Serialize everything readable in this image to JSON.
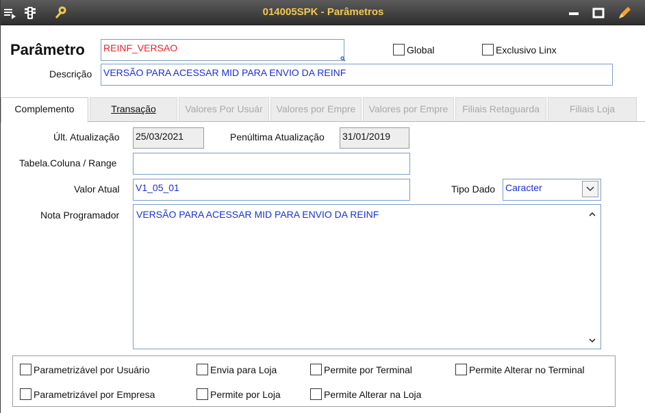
{
  "window": {
    "title": "014005SPK - Parâmetros",
    "icons": [
      "menu-list-icon",
      "traffic-light-icon",
      "wrench-icon",
      "minimize-icon",
      "maximize-icon",
      "pencil-icon"
    ]
  },
  "header": {
    "parametro_label": "Parâmetro",
    "parametro_value": "REINF_VERSAO",
    "descricao_label": "Descrição",
    "descricao_value": "VERSÃO PARA ACESSAR MID PARA ENVIO DA REINF",
    "global_label": "Global",
    "exclusivo_label": "Exclusivo Linx"
  },
  "tabs": [
    {
      "label": "Complemento",
      "state": "active"
    },
    {
      "label": "Transação",
      "state": "enabled"
    },
    {
      "label": "Valores Por Usuár",
      "state": "disabled"
    },
    {
      "label": "Valores por Empre",
      "state": "disabled"
    },
    {
      "label": "Valores por Empre",
      "state": "disabled"
    },
    {
      "label": "Filiais Retaguarda",
      "state": "disabled"
    },
    {
      "label": "Filiais Loja",
      "state": "disabled"
    }
  ],
  "complemento": {
    "ult_atualizacao_label": "Últ. Atualização",
    "ult_atualizacao_value": "25/03/2021",
    "penultima_label": "Penúltima Atualização",
    "penultima_value": "31/01/2019",
    "tabela_label": "Tabela.Coluna / Range",
    "tabela_value": "",
    "valor_atual_label": "Valor Atual",
    "valor_atual_value": "V1_05_01",
    "tipo_dado_label": "Tipo Dado",
    "tipo_dado_value": "Caracter",
    "nota_label": "Nota Programador",
    "nota_value": "VERSÃO PARA ACESSAR MID PARA ENVIO DA REINF"
  },
  "options": {
    "param_usuario": "Parametrizável por Usuário",
    "envia_loja": "Envia para Loja",
    "permite_terminal": "Permite por Terminal",
    "alterar_terminal": "Permite Alterar no Terminal",
    "param_empresa": "Parametrizável por Empresa",
    "permite_loja": "Permite por Loja",
    "alterar_loja": "Permite Alterar na Loja"
  },
  "colors": {
    "title_text": "#f2c94c",
    "value_blue": "#1b2fd2",
    "value_red": "#e8202a"
  }
}
